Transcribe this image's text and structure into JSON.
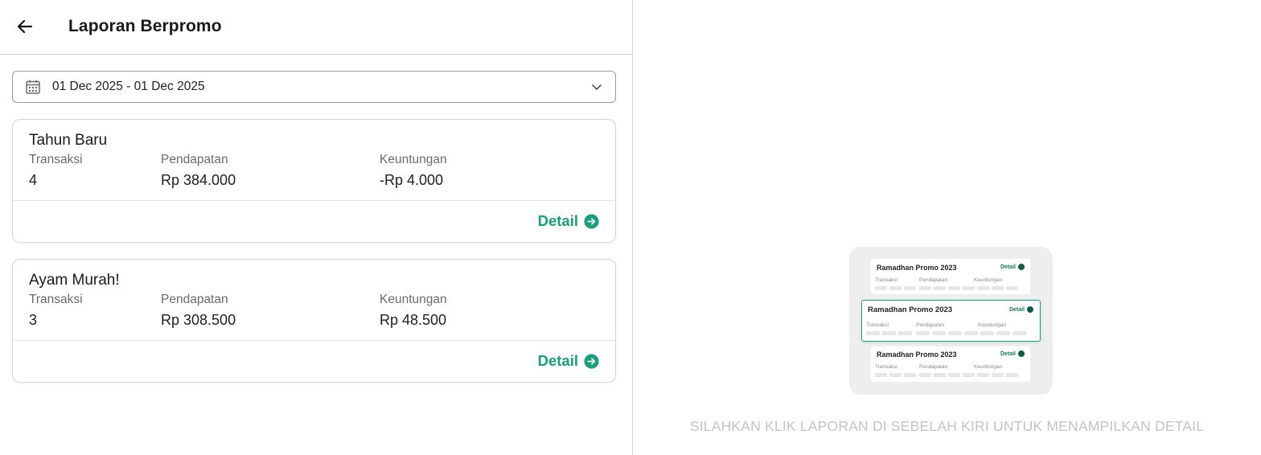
{
  "header": {
    "title": "Laporan Berpromo"
  },
  "filter": {
    "date_range": "01 Dec 2025 - 01 Dec 2025"
  },
  "reports": [
    {
      "name": "Tahun Baru",
      "transaksi_label": "Transaksi",
      "transaksi": "4",
      "pendapatan_label": "Pendapatan",
      "pendapatan": "Rp 384.000",
      "keuntungan_label": "Keuntungan",
      "keuntungan": "-Rp 4.000",
      "detail_label": "Detail"
    },
    {
      "name": "Ayam Murah!",
      "transaksi_label": "Transaksi",
      "transaksi": "3",
      "pendapatan_label": "Pendapatan",
      "pendapatan": "Rp 308.500",
      "keuntungan_label": "Keuntungan",
      "keuntungan": "Rp 48.500",
      "detail_label": "Detail"
    }
  ],
  "illustration": {
    "card_title": "Ramadhan Promo 2023",
    "detail": "Detail",
    "col1": "Transaksi",
    "col2": "Pendapatan",
    "col3": "Keuntungan"
  },
  "empty_state": {
    "message": "SILAHKAN KLIK LAPORAN DI SEBELAH KIRI UNTUK MENAMPILKAN DETAIL"
  },
  "colors": {
    "accent": "#18a07a",
    "muted": "#c4c4c4"
  }
}
